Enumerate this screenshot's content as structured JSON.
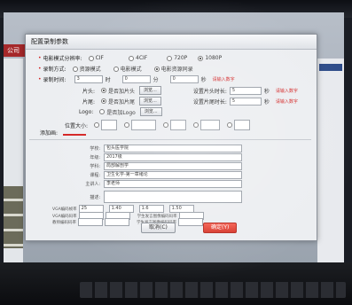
{
  "background_app": {
    "title": "公司"
  },
  "dialog": {
    "title": "配置录制参数",
    "resolution": {
      "label": "电影模式分辨率:",
      "options": [
        "CIF",
        "4CIF",
        "720P",
        "1080P"
      ],
      "selected": "1080P"
    },
    "record_mode": {
      "label": "录制方式:",
      "options": [
        "资源模式",
        "电影模式",
        "电影资源同录"
      ],
      "selected": "电影资源同录"
    },
    "record_time": {
      "label": "录制时间:",
      "hours": "3",
      "hours_unit": "时",
      "minutes": "0",
      "minutes_unit": "分",
      "seconds": "0",
      "seconds_unit": "秒",
      "hint": "请输入数字"
    },
    "intro": {
      "label": "片头:",
      "checkbox_label": "是否加片头",
      "browse": "浏览...",
      "duration_label": "设置片头时长:",
      "duration_value": "5",
      "unit": "秒",
      "hint": "请输入数字"
    },
    "outro": {
      "label": "片尾:",
      "checkbox_label": "是否加片尾",
      "browse": "浏览...",
      "duration_label": "设置片尾时长:",
      "duration_value": "5",
      "unit": "秒",
      "hint": "请输入数字"
    },
    "logo": {
      "label": "Logo:",
      "checkbox_label": "是否加Logo",
      "browse": "浏览..."
    },
    "position": {
      "label": "位置大小:"
    },
    "watermark": {
      "label": "添加画:"
    },
    "info_fields": [
      {
        "label": "学校:",
        "value": "包头医学院"
      },
      {
        "label": "年级:",
        "value": "2017级"
      },
      {
        "label": "学科:",
        "value": "局部解剖学"
      },
      {
        "label": "课程:",
        "value": "卫生化学-第一章绪论"
      },
      {
        "label": "主讲人:",
        "value": "李老师"
      },
      {
        "label": "描述:",
        "value": ""
      }
    ],
    "params": [
      {
        "label": "VGA编码帧率",
        "values": [
          "25",
          "1.40",
          "1.6",
          "1.50"
        ]
      },
      {
        "label": "VGA编码码率",
        "values": [
          "",
          ""
        ],
        "label2": "学生发言图像编码码率",
        "values2": [
          ""
        ]
      },
      {
        "label": "教师编码码率",
        "values": [
          "",
          ""
        ],
        "label2": "学生发言图像编码码率",
        "values2": [
          ""
        ]
      },
      {
        "label": "学生编码码率",
        "values": [
          "",
          ""
        ],
        "label2": "学生发言图像编码码率",
        "values2": [
          ""
        ]
      }
    ],
    "buttons": {
      "cancel": "取消(C)",
      "confirm": "确定(Y)"
    }
  },
  "colors": {
    "accent": "#d31f1f",
    "confirm_button": "#e0463a",
    "dialog_bg": "#eceef1"
  }
}
